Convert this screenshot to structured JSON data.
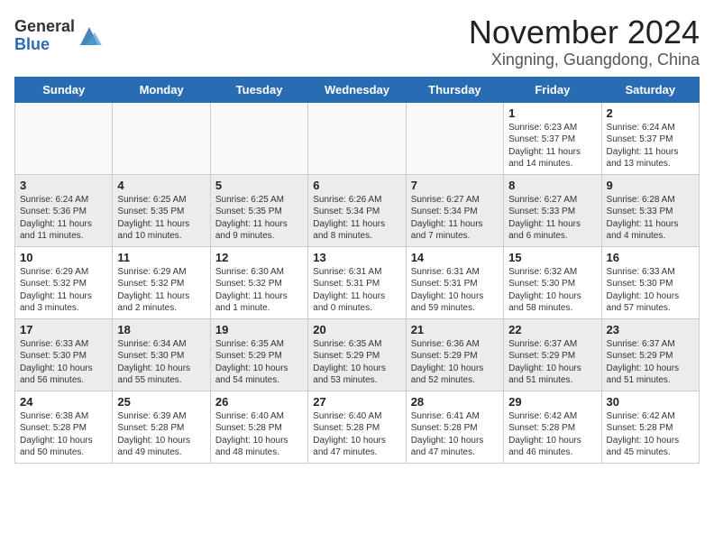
{
  "header": {
    "logo_general": "General",
    "logo_blue": "Blue",
    "month_title": "November 2024",
    "location": "Xingning, Guangdong, China"
  },
  "days_of_week": [
    "Sunday",
    "Monday",
    "Tuesday",
    "Wednesday",
    "Thursday",
    "Friday",
    "Saturday"
  ],
  "weeks": [
    {
      "alt": false,
      "days": [
        {
          "empty": true
        },
        {
          "empty": true
        },
        {
          "empty": true
        },
        {
          "empty": true
        },
        {
          "empty": true
        },
        {
          "num": "1",
          "lines": [
            "Sunrise: 6:23 AM",
            "Sunset: 5:37 PM",
            "Daylight: 11 hours",
            "and 14 minutes."
          ]
        },
        {
          "num": "2",
          "lines": [
            "Sunrise: 6:24 AM",
            "Sunset: 5:37 PM",
            "Daylight: 11 hours",
            "and 13 minutes."
          ]
        }
      ]
    },
    {
      "alt": true,
      "days": [
        {
          "num": "3",
          "lines": [
            "Sunrise: 6:24 AM",
            "Sunset: 5:36 PM",
            "Daylight: 11 hours",
            "and 11 minutes."
          ]
        },
        {
          "num": "4",
          "lines": [
            "Sunrise: 6:25 AM",
            "Sunset: 5:35 PM",
            "Daylight: 11 hours",
            "and 10 minutes."
          ]
        },
        {
          "num": "5",
          "lines": [
            "Sunrise: 6:25 AM",
            "Sunset: 5:35 PM",
            "Daylight: 11 hours",
            "and 9 minutes."
          ]
        },
        {
          "num": "6",
          "lines": [
            "Sunrise: 6:26 AM",
            "Sunset: 5:34 PM",
            "Daylight: 11 hours",
            "and 8 minutes."
          ]
        },
        {
          "num": "7",
          "lines": [
            "Sunrise: 6:27 AM",
            "Sunset: 5:34 PM",
            "Daylight: 11 hours",
            "and 7 minutes."
          ]
        },
        {
          "num": "8",
          "lines": [
            "Sunrise: 6:27 AM",
            "Sunset: 5:33 PM",
            "Daylight: 11 hours",
            "and 6 minutes."
          ]
        },
        {
          "num": "9",
          "lines": [
            "Sunrise: 6:28 AM",
            "Sunset: 5:33 PM",
            "Daylight: 11 hours",
            "and 4 minutes."
          ]
        }
      ]
    },
    {
      "alt": false,
      "days": [
        {
          "num": "10",
          "lines": [
            "Sunrise: 6:29 AM",
            "Sunset: 5:32 PM",
            "Daylight: 11 hours",
            "and 3 minutes."
          ]
        },
        {
          "num": "11",
          "lines": [
            "Sunrise: 6:29 AM",
            "Sunset: 5:32 PM",
            "Daylight: 11 hours",
            "and 2 minutes."
          ]
        },
        {
          "num": "12",
          "lines": [
            "Sunrise: 6:30 AM",
            "Sunset: 5:32 PM",
            "Daylight: 11 hours",
            "and 1 minute."
          ]
        },
        {
          "num": "13",
          "lines": [
            "Sunrise: 6:31 AM",
            "Sunset: 5:31 PM",
            "Daylight: 11 hours",
            "and 0 minutes."
          ]
        },
        {
          "num": "14",
          "lines": [
            "Sunrise: 6:31 AM",
            "Sunset: 5:31 PM",
            "Daylight: 10 hours",
            "and 59 minutes."
          ]
        },
        {
          "num": "15",
          "lines": [
            "Sunrise: 6:32 AM",
            "Sunset: 5:30 PM",
            "Daylight: 10 hours",
            "and 58 minutes."
          ]
        },
        {
          "num": "16",
          "lines": [
            "Sunrise: 6:33 AM",
            "Sunset: 5:30 PM",
            "Daylight: 10 hours",
            "and 57 minutes."
          ]
        }
      ]
    },
    {
      "alt": true,
      "days": [
        {
          "num": "17",
          "lines": [
            "Sunrise: 6:33 AM",
            "Sunset: 5:30 PM",
            "Daylight: 10 hours",
            "and 56 minutes."
          ]
        },
        {
          "num": "18",
          "lines": [
            "Sunrise: 6:34 AM",
            "Sunset: 5:30 PM",
            "Daylight: 10 hours",
            "and 55 minutes."
          ]
        },
        {
          "num": "19",
          "lines": [
            "Sunrise: 6:35 AM",
            "Sunset: 5:29 PM",
            "Daylight: 10 hours",
            "and 54 minutes."
          ]
        },
        {
          "num": "20",
          "lines": [
            "Sunrise: 6:35 AM",
            "Sunset: 5:29 PM",
            "Daylight: 10 hours",
            "and 53 minutes."
          ]
        },
        {
          "num": "21",
          "lines": [
            "Sunrise: 6:36 AM",
            "Sunset: 5:29 PM",
            "Daylight: 10 hours",
            "and 52 minutes."
          ]
        },
        {
          "num": "22",
          "lines": [
            "Sunrise: 6:37 AM",
            "Sunset: 5:29 PM",
            "Daylight: 10 hours",
            "and 51 minutes."
          ]
        },
        {
          "num": "23",
          "lines": [
            "Sunrise: 6:37 AM",
            "Sunset: 5:29 PM",
            "Daylight: 10 hours",
            "and 51 minutes."
          ]
        }
      ]
    },
    {
      "alt": false,
      "days": [
        {
          "num": "24",
          "lines": [
            "Sunrise: 6:38 AM",
            "Sunset: 5:28 PM",
            "Daylight: 10 hours",
            "and 50 minutes."
          ]
        },
        {
          "num": "25",
          "lines": [
            "Sunrise: 6:39 AM",
            "Sunset: 5:28 PM",
            "Daylight: 10 hours",
            "and 49 minutes."
          ]
        },
        {
          "num": "26",
          "lines": [
            "Sunrise: 6:40 AM",
            "Sunset: 5:28 PM",
            "Daylight: 10 hours",
            "and 48 minutes."
          ]
        },
        {
          "num": "27",
          "lines": [
            "Sunrise: 6:40 AM",
            "Sunset: 5:28 PM",
            "Daylight: 10 hours",
            "and 47 minutes."
          ]
        },
        {
          "num": "28",
          "lines": [
            "Sunrise: 6:41 AM",
            "Sunset: 5:28 PM",
            "Daylight: 10 hours",
            "and 47 minutes."
          ]
        },
        {
          "num": "29",
          "lines": [
            "Sunrise: 6:42 AM",
            "Sunset: 5:28 PM",
            "Daylight: 10 hours",
            "and 46 minutes."
          ]
        },
        {
          "num": "30",
          "lines": [
            "Sunrise: 6:42 AM",
            "Sunset: 5:28 PM",
            "Daylight: 10 hours",
            "and 45 minutes."
          ]
        }
      ]
    }
  ]
}
